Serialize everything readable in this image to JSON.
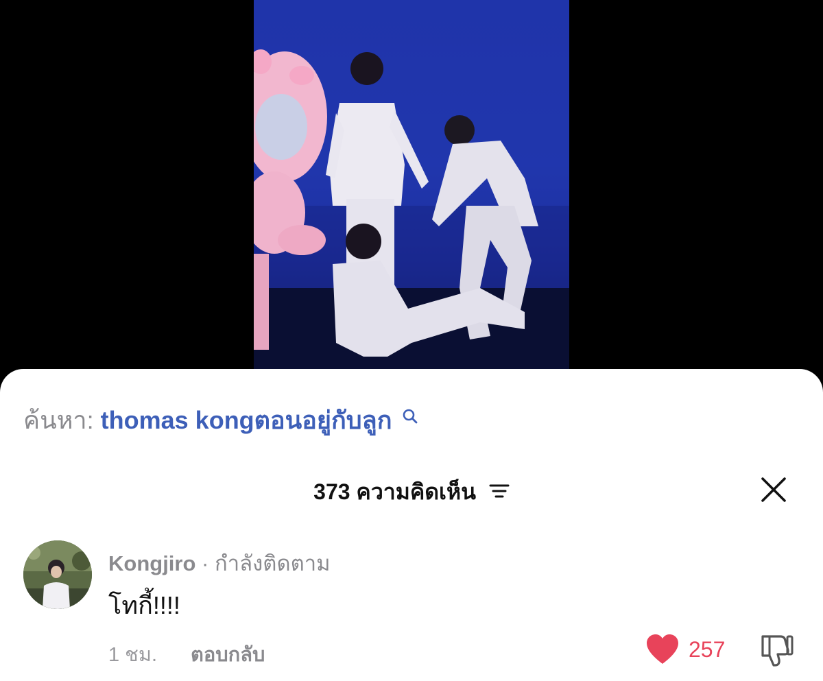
{
  "search": {
    "prefix": "ค้นหา:",
    "query": "thomas kongตอนอยู่กับลูก"
  },
  "comments_panel": {
    "count": "373",
    "title": "ความคิดเห็น"
  },
  "comment": {
    "username": "Kongjiro",
    "separator": "·",
    "follow_status": "กำลังติดตาม",
    "text": "โทกี้!!!!",
    "time": "1 ชม.",
    "reply_label": "ตอบกลับ",
    "like_count": "257"
  },
  "colors": {
    "accent_link": "#3d5fb8",
    "like_red": "#e8435a",
    "muted_text": "#8a8a8e",
    "video_stage_blue": "#1e34a6"
  },
  "icons": [
    "search-icon",
    "sort-icon",
    "close-icon",
    "heart-icon",
    "thumbs-down-icon"
  ]
}
